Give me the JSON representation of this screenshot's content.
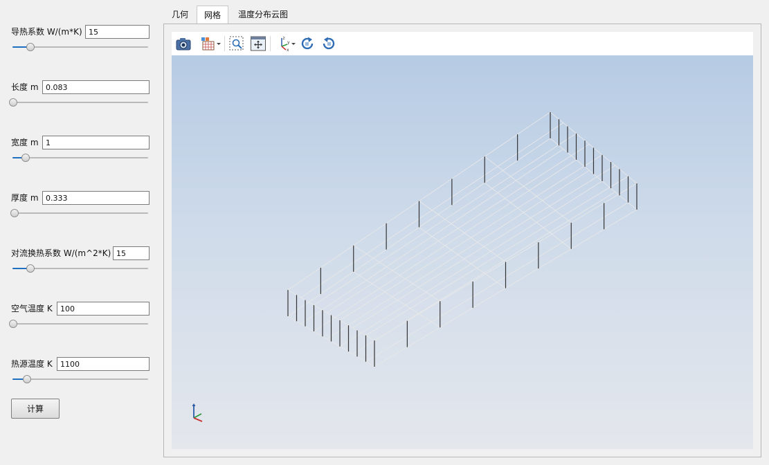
{
  "parameters": [
    {
      "label": "导热系数 W/(m*K)",
      "value": "15",
      "slider_fraction": 0.13
    },
    {
      "label": "长度 m",
      "value": "0.083",
      "slider_fraction": 0.0
    },
    {
      "label": "宽度 m",
      "value": "1",
      "slider_fraction": 0.09
    },
    {
      "label": "厚度 m",
      "value": "0.333",
      "slider_fraction": 0.01
    },
    {
      "label": "对流换热系数 W/(m^2*K)",
      "value": "15",
      "slider_fraction": 0.13
    },
    {
      "label": "空气温度 K",
      "value": "100",
      "slider_fraction": 0.0
    },
    {
      "label": "热源温度 K",
      "value": "1100",
      "slider_fraction": 0.1
    }
  ],
  "calc_button": "计算",
  "tabs": [
    {
      "label": "几何",
      "active": false
    },
    {
      "label": "网格",
      "active": true
    },
    {
      "label": "温度分布云图",
      "active": false
    }
  ],
  "toolbar": [
    "camera-icon",
    "display-mode-icon",
    "zoom-box-icon",
    "fit-view-icon",
    "axes-view-icon",
    "rotate-cw-icon",
    "rotate-ccw-icon"
  ],
  "viewport": {
    "content": "mesh-wireframe",
    "background_top": "#b6cbe4",
    "background_bottom": "#e4e7ec"
  },
  "colors": {
    "slider_accent": "#1e6fc1",
    "mesh_lines": "#e8e8e8",
    "mesh_bars": "#333333"
  }
}
